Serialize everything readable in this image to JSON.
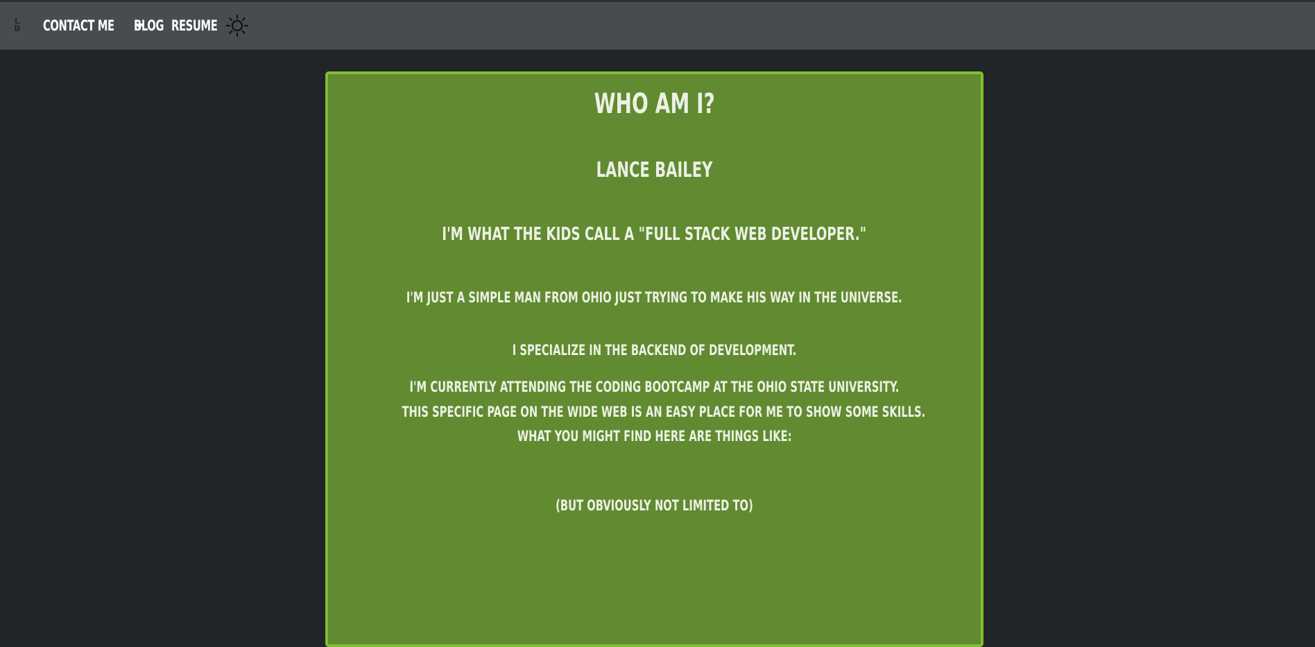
{
  "brand": {
    "letter1": "L",
    "letter2": "B"
  },
  "nav": {
    "contact_label": "CONTACT ME",
    "blog_label": "BLOG",
    "resume_label": "RESUME",
    "theme_toggle_icon": "sun-icon"
  },
  "about": {
    "title": "WHO AM I?",
    "name": "LANCE BAILEY",
    "tagline": "I'M WHAT THE KIDS CALL A \"FULL STACK WEB DEVELOPER.\"",
    "line1": "I'M JUST A SIMPLE MAN FROM OHIO JUST TRYING TO MAKE HIS WAY IN THE UNIVERSE.",
    "line2": "I SPECIALIZE IN THE BACKEND OF DEVELOPMENT.",
    "line3": "I'M CURRENTLY ATTENDING THE CODING BOOTCAMP AT THE OHIO STATE UNIVERSITY.",
    "line4": "THIS SPECIFIC PAGE ON THE WIDE WEB IS AN EASY PLACE FOR ME TO SHOW SOME SKILLS.",
    "line5": "WHAT YOU MIGHT FIND HERE ARE THINGS LIKE:",
    "line6": "(BUT OBVIOUSLY NOT LIMITED TO)"
  },
  "colors": {
    "background": "#212529",
    "navbar": "#484c51",
    "card": "#618a31",
    "card_border": "#7fbf2e",
    "text": "#ecf1e4"
  }
}
